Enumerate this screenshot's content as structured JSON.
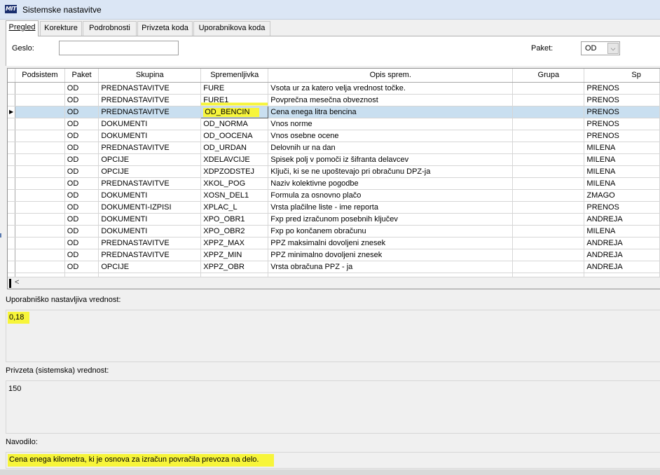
{
  "window": {
    "title": "Sistemske nastavitve",
    "logo_text": "MIT"
  },
  "tabs": [
    {
      "label": "Pregled",
      "active": true
    },
    {
      "label": "Korekture",
      "active": false
    },
    {
      "label": "Podrobnosti",
      "active": false
    },
    {
      "label": "Privzeta koda",
      "active": false
    },
    {
      "label": "Uporabnikova koda",
      "active": false
    }
  ],
  "filter": {
    "geslo_label": "Geslo:",
    "geslo_value": "",
    "paket_label": "Paket:",
    "paket_value": "OD",
    "dropdown_glyph": "⌵"
  },
  "grid": {
    "columns": [
      "Podsistem",
      "Paket",
      "Skupina",
      "Spremenljivka",
      "Opis sprem.",
      "Grupa",
      "Sp"
    ],
    "selected_row_index": 2,
    "rows": [
      {
        "podsistem": "",
        "paket": "OD",
        "skupina": "PREDNASTAVITVE",
        "spremenljivka": "FURE",
        "opis": "Vsota ur za katero velja vrednost točke.",
        "grupa": "",
        "sp": "PRENOS"
      },
      {
        "podsistem": "",
        "paket": "OD",
        "skupina": "PREDNASTAVITVE",
        "spremenljivka": "FURE1",
        "opis": "Povprečna mesečna obveznost",
        "grupa": "",
        "sp": "PRENOS"
      },
      {
        "podsistem": "",
        "paket": "OD",
        "skupina": "PREDNASTAVITVE",
        "spremenljivka": "OD_BENCIN",
        "opis": "Cena enega litra bencina",
        "grupa": "",
        "sp": "PRENOS"
      },
      {
        "podsistem": "",
        "paket": "OD",
        "skupina": "DOKUMENTI",
        "spremenljivka": "OD_NORMA",
        "opis": "Vnos norme",
        "grupa": "",
        "sp": "PRENOS"
      },
      {
        "podsistem": "",
        "paket": "OD",
        "skupina": "DOKUMENTI",
        "spremenljivka": "OD_OOCENA",
        "opis": "Vnos osebne ocene",
        "grupa": "",
        "sp": "PRENOS"
      },
      {
        "podsistem": "",
        "paket": "OD",
        "skupina": "PREDNASTAVITVE",
        "spremenljivka": "OD_URDAN",
        "opis": "Delovnih ur na dan",
        "grupa": "",
        "sp": "MILENA"
      },
      {
        "podsistem": "",
        "paket": "OD",
        "skupina": "OPCIJE",
        "spremenljivka": "XDELAVCIJE",
        "opis": "Spisek polj v pomoči iz šifranta delavcev",
        "grupa": "",
        "sp": "MILENA"
      },
      {
        "podsistem": "",
        "paket": "OD",
        "skupina": "OPCIJE",
        "spremenljivka": "XDPZODSTEJ",
        "opis": "Ključi, ki se ne upoštevajo pri obračunu DPZ-ja",
        "grupa": "",
        "sp": "MILENA"
      },
      {
        "podsistem": "",
        "paket": "OD",
        "skupina": "PREDNASTAVITVE",
        "spremenljivka": "XKOL_POG",
        "opis": "Naziv kolektivne pogodbe",
        "grupa": "",
        "sp": "MILENA"
      },
      {
        "podsistem": "",
        "paket": "OD",
        "skupina": "DOKUMENTI",
        "spremenljivka": "XOSN_DEL1",
        "opis": "Formula za osnovno plačo",
        "grupa": "",
        "sp": "ZMAGO"
      },
      {
        "podsistem": "",
        "paket": "OD",
        "skupina": "DOKUMENTI-IZPISI",
        "spremenljivka": "XPLAC_L",
        "opis": "Vrsta plačilne liste - ime reporta",
        "grupa": "",
        "sp": "PRENOS"
      },
      {
        "podsistem": "",
        "paket": "OD",
        "skupina": "DOKUMENTI",
        "spremenljivka": "XPO_OBR1",
        "opis": "Fxp pred izračunom posebnih ključev",
        "grupa": "",
        "sp": "ANDREJA"
      },
      {
        "podsistem": "",
        "paket": "OD",
        "skupina": "DOKUMENTI",
        "spremenljivka": "XPO_OBR2",
        "opis": "Fxp po končanem obračunu",
        "grupa": "",
        "sp": "MILENA"
      },
      {
        "podsistem": "",
        "paket": "OD",
        "skupina": "PREDNASTAVITVE",
        "spremenljivka": "XPPZ_MAX",
        "opis": "PPZ maksimalni dovoljeni znesek",
        "grupa": "",
        "sp": "ANDREJA"
      },
      {
        "podsistem": "",
        "paket": "OD",
        "skupina": "PREDNASTAVITVE",
        "spremenljivka": "XPPZ_MIN",
        "opis": "PPZ minimalno dovoljeni znesek",
        "grupa": "",
        "sp": "ANDREJA"
      },
      {
        "podsistem": "",
        "paket": "OD",
        "skupina": "OPCIJE",
        "spremenljivka": "XPPZ_OBR",
        "opis": "Vrsta obračuna PPZ - ja",
        "grupa": "",
        "sp": "ANDREJA"
      }
    ],
    "scroll_left_glyph": "<"
  },
  "user_value": {
    "label": "Uporabniško nastavljiva vrednost:",
    "value": "0,18"
  },
  "default_value": {
    "label": "Privzeta (sistemska) vrednost:",
    "value": "150"
  },
  "instructions": {
    "label": "Navodilo:",
    "value": "Cena enega kilometra, ki je osnova za izračun povračila prevoza na delo."
  },
  "colors": {
    "highlight": "#f7f53a",
    "selected_row": "#c9dff0",
    "titlebar": "#dbe6f5"
  }
}
